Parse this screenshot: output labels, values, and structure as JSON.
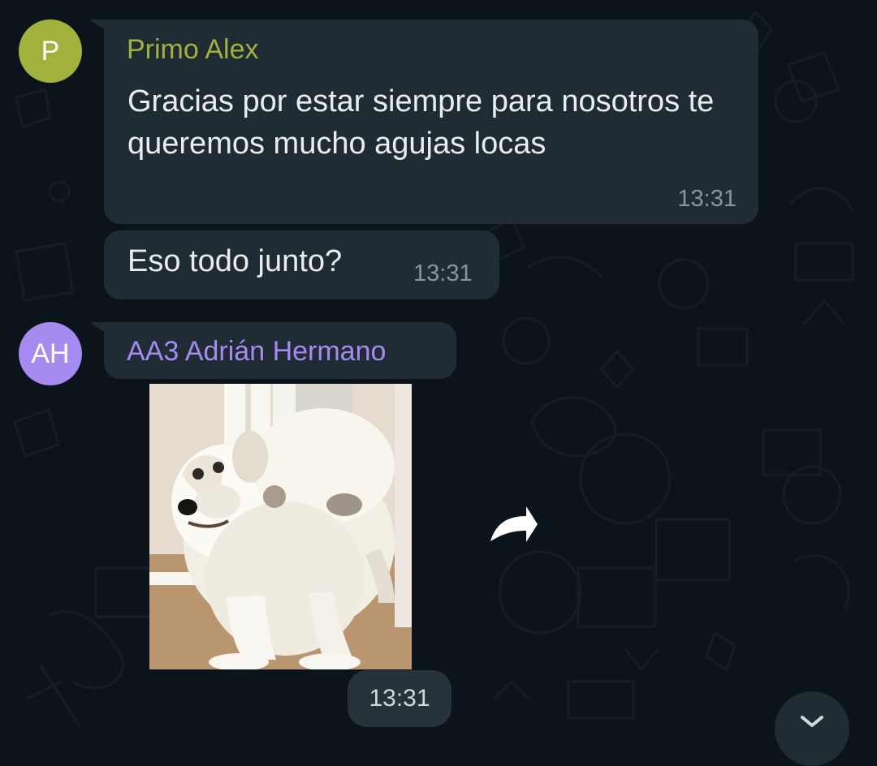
{
  "messages": [
    {
      "avatar_initials": "P",
      "sender": "Primo Alex",
      "text": "Gracias por estar siempre para nosotros te queremos mucho agujas locas",
      "time": "13:31"
    },
    {
      "text": "Eso todo junto?",
      "time": "13:31"
    },
    {
      "avatar_initials": "AH",
      "sender": "AA3 Adrián Hermano",
      "time": "13:31"
    }
  ],
  "colors": {
    "background": "#0b141a",
    "bubble": "#202c33",
    "sender_alex": "#a1b13b",
    "sender_adrian": "#a58af0",
    "timestamp": "#8696a0"
  },
  "icons": [
    "forward-icon",
    "chevron-down-icon"
  ]
}
